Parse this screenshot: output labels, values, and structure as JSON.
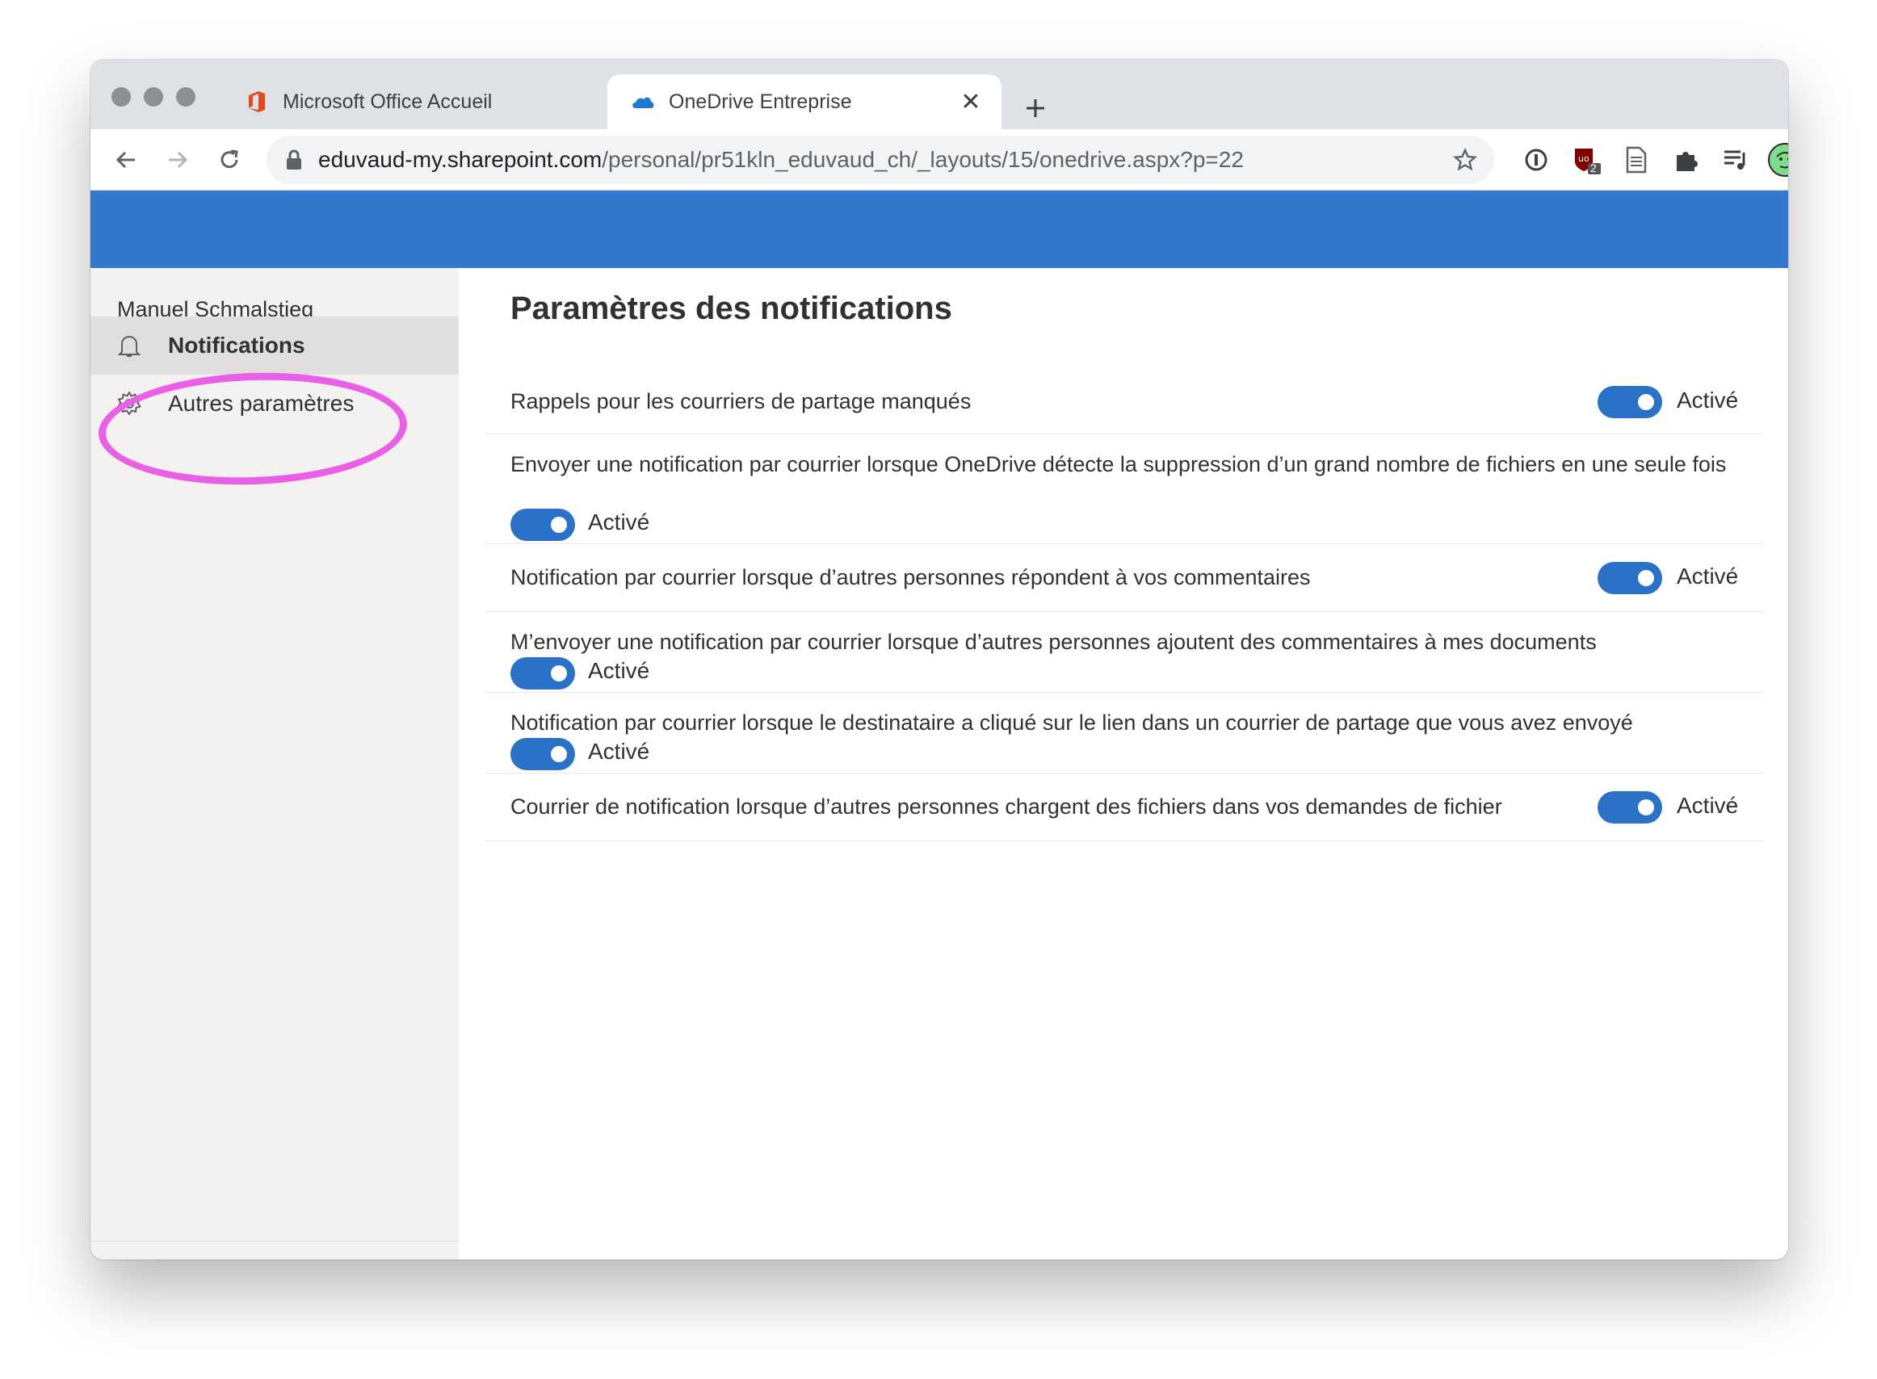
{
  "browser": {
    "tabs": [
      {
        "title": "Microsoft Office Accueil",
        "active": false,
        "icon": "office-icon"
      },
      {
        "title": "OneDrive Entreprise",
        "active": true,
        "icon": "onedrive-icon"
      }
    ],
    "close_glyph": "✕",
    "url_host": "eduvaud-my.sharepoint.com",
    "url_path": "/personal/pr51kln_eduvaud_ch/_layouts/15/onedrive.aspx?p=22",
    "extension_badge": "2"
  },
  "colors": {
    "suite_bar": "#3278cc",
    "toggle_on": "#2a72c8",
    "highlight_annotation": "#e960e6"
  },
  "sidebar": {
    "user_name": "Manuel Schmalstieg",
    "items": [
      {
        "label": "Notifications",
        "icon": "bell-icon",
        "selected": true
      },
      {
        "label": "Autres paramètres",
        "icon": "gear-icon",
        "selected": false
      }
    ]
  },
  "main": {
    "title": "Paramètres des notifications",
    "settings": [
      {
        "text": "Rappels pour les courriers de partage manqués",
        "state": "Activé",
        "on": true
      },
      {
        "text": "Envoyer une notification par courrier lorsque OneDrive détecte la suppression d’un grand nombre de fichiers en une seule fois",
        "state": "Activé",
        "on": true
      },
      {
        "text": "Notification par courrier lorsque d’autres personnes répondent à vos commentaires",
        "state": "Activé",
        "on": true
      },
      {
        "text": "M’envoyer une notification par courrier lorsque d’autres personnes ajoutent des commentaires à mes documents",
        "state": "Activé",
        "on": true
      },
      {
        "text": "Notification par courrier lorsque le destinataire a cliqué sur le lien dans un courrier de partage que vous avez envoyé",
        "state": "Activé",
        "on": true
      },
      {
        "text": "Courrier de notification lorsque d’autres personnes chargent des fichiers dans vos demandes de fichier",
        "state": "Activé",
        "on": true
      }
    ]
  }
}
